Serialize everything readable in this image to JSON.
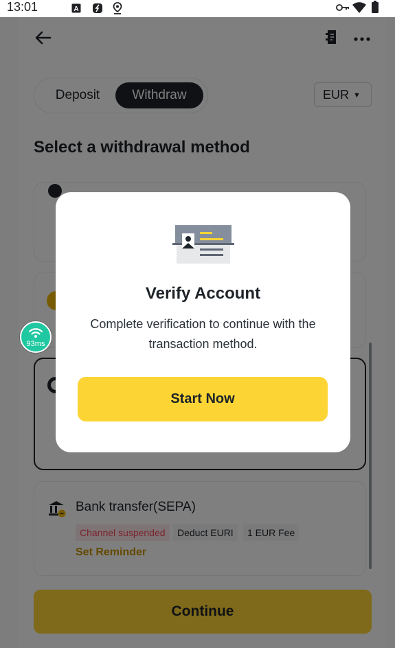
{
  "status_bar": {
    "time": "13:01",
    "left_icons": [
      "a-box-icon",
      "signal-app-icon",
      "location-icon"
    ],
    "right_icons": [
      "key-icon",
      "wifi-icon",
      "battery-icon"
    ]
  },
  "header": {
    "back_icon": "arrow-left-icon",
    "doc_icon": "document-icon",
    "more_icon": "more-icon"
  },
  "tabs": {
    "deposit_label": "Deposit",
    "withdraw_label": "Withdraw",
    "active": "Withdraw"
  },
  "currency": {
    "selected": "EUR"
  },
  "section": {
    "title": "Select a withdrawal method"
  },
  "methods": [
    {
      "title": "Bank transfer(SEPA)",
      "tags": [
        "Channel suspended",
        "Deduct EURI",
        "1 EUR Fee"
      ],
      "reminder_label": "Set Reminder"
    }
  ],
  "continue_label": "Continue",
  "modal": {
    "title": "Verify Account",
    "description": "Complete verification to continue with the transaction method.",
    "button_label": "Start Now"
  },
  "network_badge": {
    "label": "93ms"
  },
  "colors": {
    "brand_yellow": "#fcd535",
    "dark": "#1e2329",
    "danger": "#f6465d",
    "gold_text": "#c99400",
    "badge_green": "#1fc8a0"
  }
}
